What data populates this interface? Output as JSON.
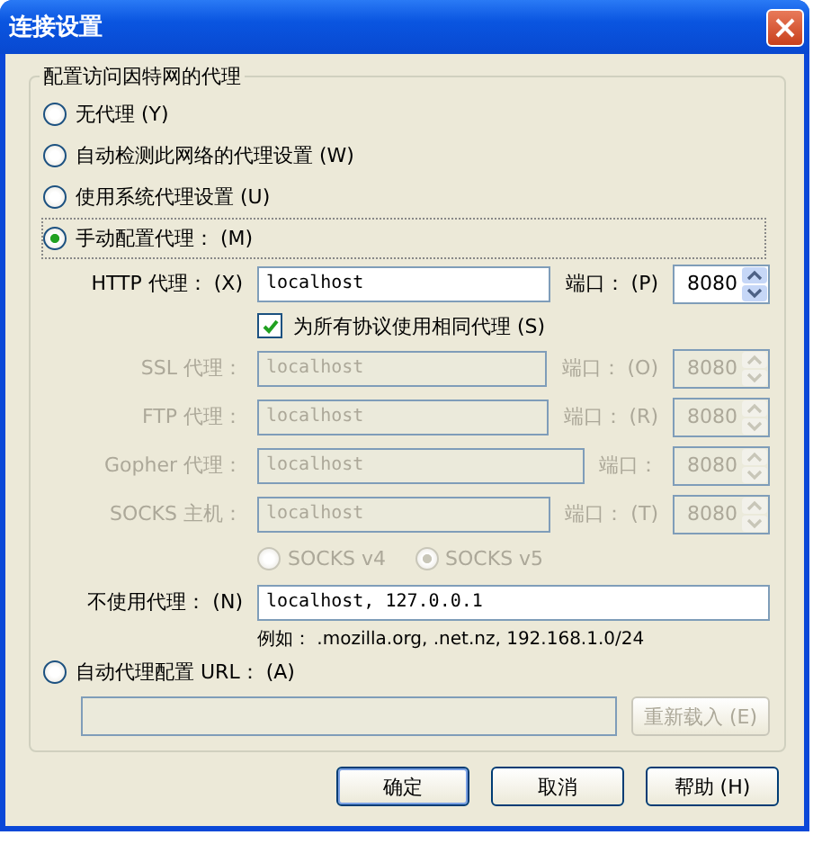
{
  "window": {
    "title": "连接设置"
  },
  "group": {
    "title": "配置访问因特网的代理"
  },
  "modes": [
    {
      "label": "无代理 (Y)",
      "selected": false
    },
    {
      "label": "自动检测此网络的代理设置 (W)",
      "selected": false
    },
    {
      "label": "使用系统代理设置 (U)",
      "selected": false
    },
    {
      "label": "手动配置代理： (M)",
      "selected": true
    }
  ],
  "proxies": [
    {
      "label": "HTTP 代理： (X)",
      "value": "localhost",
      "port_label": "端口： (P)",
      "port": "8080",
      "disabled": false
    },
    {
      "label": "SSL 代理：",
      "value": "localhost",
      "port_label": "端口： (O)",
      "port": "8080",
      "disabled": true
    },
    {
      "label": "FTP 代理：",
      "value": "localhost",
      "port_label": "端口： (R)",
      "port": "8080",
      "disabled": true
    },
    {
      "label": "Gopher 代理：",
      "value": "localhost",
      "port_label": "端口：",
      "port": "8080",
      "disabled": true
    },
    {
      "label": "SOCKS 主机：",
      "value": "localhost",
      "port_label": "端口： (T)",
      "port": "8080",
      "disabled": true
    }
  ],
  "same_for_all": {
    "label": "为所有协议使用相同代理 (S)",
    "checked": true
  },
  "socks_versions": [
    {
      "label": "SOCKS v4",
      "selected": false,
      "disabled": true
    },
    {
      "label": "SOCKS v5",
      "selected": true,
      "disabled": true
    }
  ],
  "no_proxy": {
    "label": "不使用代理： (N)",
    "value": "localhost, 127.0.0.1",
    "example": "例如： .mozilla.org, .net.nz, 192.168.1.0/24"
  },
  "auto_config": {
    "label": "自动代理配置 URL： (A)",
    "selected": false,
    "disabled_field": true,
    "reload": {
      "label": "重新载入 (E)",
      "disabled": true
    }
  },
  "buttons": [
    {
      "label": "确定",
      "default": true
    },
    {
      "label": "取消",
      "default": false
    },
    {
      "label": "帮助 (H)",
      "default": false
    }
  ]
}
